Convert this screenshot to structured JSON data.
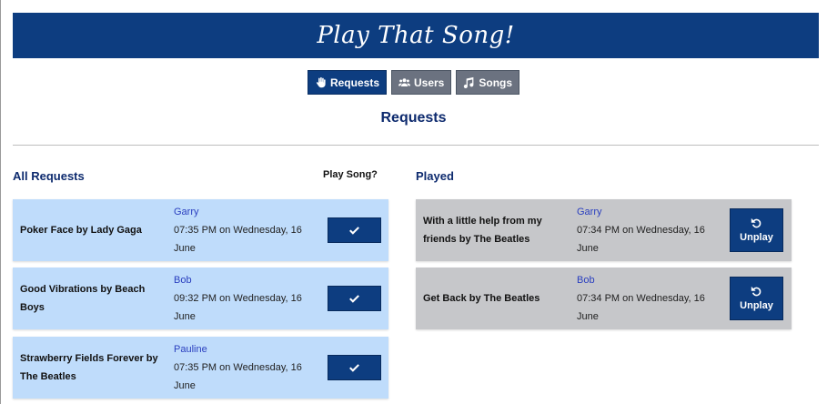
{
  "app": {
    "title": "Play That Song!"
  },
  "nav": [
    {
      "label": "Requests",
      "icon": "hand-icon",
      "active": true
    },
    {
      "label": "Users",
      "icon": "users-icon",
      "active": false
    },
    {
      "label": "Songs",
      "icon": "music-note-icon",
      "active": false
    }
  ],
  "page": {
    "title": "Requests"
  },
  "requests": {
    "heading": "All Requests",
    "play_column_label": "Play Song?",
    "items": [
      {
        "song": "Poker Face by Lady Gaga",
        "user": "Garry",
        "time": "07:35 PM on Wednesday, 16 June"
      },
      {
        "song": "Good Vibrations by Beach Boys",
        "user": "Bob",
        "time": "09:32 PM on Wednesday, 16 June"
      },
      {
        "song": "Strawberry Fields Forever by The Beatles",
        "user": "Pauline",
        "time": "07:35 PM on Wednesday, 16 June"
      }
    ]
  },
  "played": {
    "heading": "Played",
    "unplay_label": "Unplay",
    "items": [
      {
        "song": "With a little help from my friends by The Beatles",
        "user": "Garry",
        "time": "07:34 PM on Wednesday, 16 June"
      },
      {
        "song": "Get Back by The Beatles",
        "user": "Bob",
        "time": "07:34 PM on Wednesday, 16 June"
      }
    ]
  },
  "colors": {
    "primary": "#0d3d80",
    "request_card": "#bfdcfb",
    "played_card": "#c6c7ca",
    "nav_inactive": "#6b7280",
    "heading": "#0d2a6e",
    "user_link": "#2a3fbf"
  }
}
